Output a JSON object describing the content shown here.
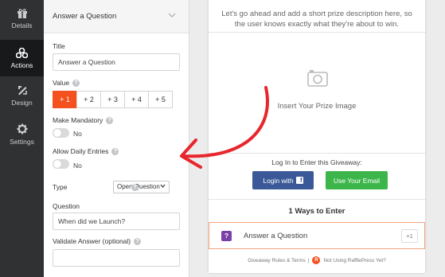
{
  "nav": {
    "items": [
      {
        "label": "Details",
        "icon": "gift-icon",
        "active": false
      },
      {
        "label": "Actions",
        "icon": "actions-icon",
        "active": true
      },
      {
        "label": "Design",
        "icon": "design-icon",
        "active": false
      },
      {
        "label": "Settings",
        "icon": "gear-icon",
        "active": false
      }
    ]
  },
  "panel": {
    "header_title": "Answer a Question",
    "title_label": "Title",
    "title_value": "Answer a Question",
    "value_label": "Value",
    "value_options": [
      "+ 1",
      "+ 2",
      "+ 3",
      "+ 4",
      "+ 5"
    ],
    "value_selected": "+ 1",
    "mandatory_label": "Make Mandatory",
    "mandatory_state": "No",
    "daily_label": "Allow Daily Entries",
    "daily_state": "No",
    "type_label": "Type",
    "type_value": "Open Question",
    "question_label": "Question",
    "question_value": "When did we Launch?",
    "validate_label": "Validate Answer (optional)",
    "validate_value": ""
  },
  "preview": {
    "description": "Let's go ahead and add a short prize description here, so the user knows exactly what they're about to win.",
    "image_placeholder": "Insert Your Prize Image",
    "login_prompt": "Log In to Enter this Giveaway:",
    "login_facebook": "Login with",
    "login_email": "Use Your Email",
    "ways_title": "1 Ways to Enter",
    "entry_title": "Answer a Question",
    "entry_points": "+1",
    "footer_rules": "Giveaway Rules & Terms",
    "footer_separator": "|",
    "footer_promo": "Not Using RafflePress Yet?"
  },
  "colors": {
    "accent": "#f4511e",
    "facebook": "#3b5998",
    "email": "#3cb64a",
    "nav_bg": "#2f3133",
    "entry_badge": "#7b3fa8",
    "arrow": "#e8262d"
  }
}
